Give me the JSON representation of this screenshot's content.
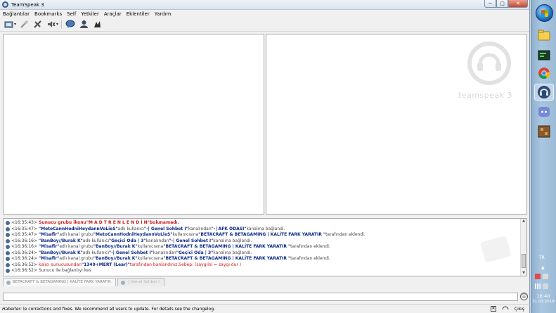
{
  "window": {
    "title": "TeamSpeak 3"
  },
  "window_controls": {
    "minimize": "−",
    "maximize": "□",
    "close": "✕"
  },
  "menu": [
    "Bağlantılar",
    "Bookmarks",
    "Self",
    "Yetkiler",
    "Araçlar",
    "Eklentiler",
    "Yardım"
  ],
  "toolbar_icons": [
    "connect-icon",
    "disconnect-icon",
    "away-icon",
    "mute-microphone-icon",
    "mute-speakers-icon",
    "chat-icon",
    "contacts-icon",
    "subscribe-icon"
  ],
  "watermark": {
    "text": "teamspeak 3"
  },
  "chat": {
    "lines": [
      {
        "time": "<16:35:43>",
        "parts": [
          {
            "t": "Sunucu grubu ikonu ",
            "s": "redb"
          },
          {
            "t": "\"M A D T R E N L E N D İ N\"",
            "s": "redb"
          },
          {
            "t": " bulunamadı.",
            "s": "redb"
          }
        ]
      },
      {
        "time": "<16:35:47>",
        "parts": [
          {
            "t": "\"MetoCannHodniHeydannVoLieS\"",
            "s": "blue"
          },
          {
            "t": " adlı kullanıcı ",
            "s": "grey"
          },
          {
            "t": "\"-| Genel Sohbet I\"",
            "s": "blue"
          },
          {
            "t": " kanalından ",
            "s": "grey"
          },
          {
            "t": "\"-| AFK ODASI\"",
            "s": "blue"
          },
          {
            "t": " kanalına bağlandı.",
            "s": "grey"
          }
        ]
      },
      {
        "time": "<16:35:47>",
        "parts": [
          {
            "t": "\"Misafir\"",
            "s": "blue"
          },
          {
            "t": " adlı kanal grubu ",
            "s": "grey"
          },
          {
            "t": "\"MetoCannHodniHeydannVoLieS\"",
            "s": "blue"
          },
          {
            "t": " kullanıcısına ",
            "s": "grey"
          },
          {
            "t": "\"BETACRAFT & BETAGAMING | KALİTE FARK YARATIR \"",
            "s": "blue"
          },
          {
            "t": " tarafından eklendi.",
            "s": "grey"
          }
        ]
      },
      {
        "time": "<16:36:16>",
        "parts": [
          {
            "t": "\"BanBoy//Burak K\"",
            "s": "blue"
          },
          {
            "t": " adlı kullanıcı ",
            "s": "grey"
          },
          {
            "t": "\"Geçici Oda | 3\"",
            "s": "blue"
          },
          {
            "t": " kanalından ",
            "s": "grey"
          },
          {
            "t": "\"-| Genel Sohbet I\"",
            "s": "blue"
          },
          {
            "t": " kanalına bağlandı.",
            "s": "grey"
          }
        ]
      },
      {
        "time": "<16:36:16>",
        "parts": [
          {
            "t": "\"Misafir\"",
            "s": "blue"
          },
          {
            "t": " adlı kanal grubu ",
            "s": "grey"
          },
          {
            "t": "\"BanBoy//Burak K\"",
            "s": "blue"
          },
          {
            "t": " kullanıcısına ",
            "s": "grey"
          },
          {
            "t": "\"BETACRAFT & BETAGAMING | KALİTE FARK YARATIR \"",
            "s": "blue"
          },
          {
            "t": " tarafından eklendi.",
            "s": "grey"
          }
        ]
      },
      {
        "time": "<16:36:24>",
        "parts": [
          {
            "t": "\"BanBoy//Burak K\"",
            "s": "blue"
          },
          {
            "t": " adlı kullanıcı ",
            "s": "grey"
          },
          {
            "t": "\"-| Genel Sohbet I\"",
            "s": "blue"
          },
          {
            "t": " kanalından ",
            "s": "grey"
          },
          {
            "t": "\"Geçici Oda | 3\"",
            "s": "blue"
          },
          {
            "t": " kanalına bağlandı.",
            "s": "grey"
          }
        ]
      },
      {
        "time": "<16:36:24>",
        "parts": [
          {
            "t": "\"Misafir\"",
            "s": "blue"
          },
          {
            "t": " adlı kanal grubu ",
            "s": "grey"
          },
          {
            "t": "\"BanBoy//Burak K\"",
            "s": "blue"
          },
          {
            "t": " kullanıcısına ",
            "s": "grey"
          },
          {
            "t": "\"BETACRAFT & BETAGAMING | KALİTE FARK YARATIR \"",
            "s": "blue"
          },
          {
            "t": " tarafından eklendi.",
            "s": "grey"
          }
        ]
      },
      {
        "time": "<16:36:52>",
        "parts": [
          {
            "t": "kalıcı sunucusundan ",
            "s": "red"
          },
          {
            "t": "\"1349+MERT (Lear)\"",
            "s": "blue"
          },
          {
            "t": " tarafından banlandınız.Sebep: (saygılol = saygı dur )",
            "s": "red"
          }
        ]
      },
      {
        "time": "<16:36:52>",
        "parts": [
          {
            "t": "Sunucu ile bağlantıyı kes",
            "s": "grey"
          }
        ]
      }
    ]
  },
  "tabs": [
    {
      "label": "BETACRAFT & BETAGAMING | KALİTE FARK YARATIR"
    },
    {
      "label": "-| Genel Sohbet I"
    }
  ],
  "status": {
    "label": "Haberler:",
    "news": "le corrections and fixes. We recommend all users to update. For details see the changelog.",
    "exit": "Çıkış"
  },
  "taskbar": {
    "apps": [
      "file-explorer-icon",
      "terminal-icon",
      "chrome-icon",
      "teamspeak-icon",
      "discord-icon",
      "minecraft-icon"
    ],
    "lang": "TR",
    "time": "16:40",
    "date": "31.03.2018"
  },
  "colors": {
    "accent_blue": "#0b2a88",
    "error_red": "#cc1a1a",
    "close_red": "#c8452c"
  }
}
